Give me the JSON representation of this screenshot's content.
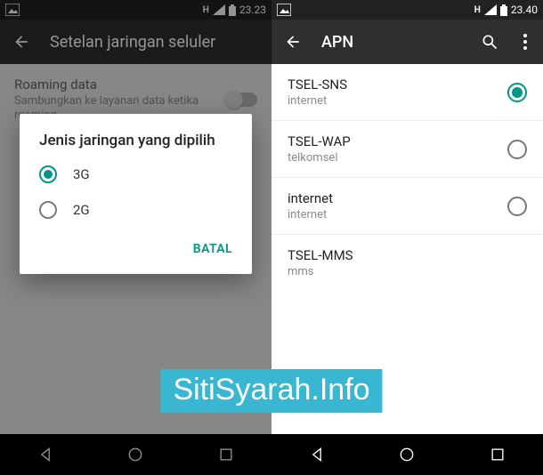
{
  "left": {
    "status_time": "23.23",
    "appbar_title": "Setelan jaringan seluler",
    "roaming_title": "Roaming data",
    "roaming_sub": "Sambungkan ke layanan data ketika roaming",
    "dialog_title": "Jenis jaringan yang dipilih",
    "options": {
      "opt1": "3G",
      "opt2": "2G"
    },
    "cancel": "BATAL"
  },
  "right": {
    "status_time": "23.40",
    "appbar_title": "APN",
    "items": [
      {
        "title": "TSEL-SNS",
        "sub": "internet"
      },
      {
        "title": "TSEL-WAP",
        "sub": "telkomsel"
      },
      {
        "title": "internet",
        "sub": "internet"
      },
      {
        "title": "TSEL-MMS",
        "sub": "mms"
      }
    ]
  },
  "watermark": "SitiSyarah.Info"
}
